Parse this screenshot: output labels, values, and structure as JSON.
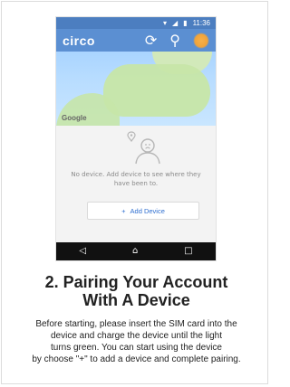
{
  "phone": {
    "status_time": "11:36",
    "app_logo": "circo",
    "map_watermark": "Google",
    "empty_message": "No device. Add device to see where they have been to.",
    "add_device_label": "Add Device",
    "icons": {
      "status": [
        "signal-icon",
        "wifi-icon",
        "battery-icon"
      ],
      "appbar": [
        "refresh-icon",
        "person-icon",
        "menu-icon"
      ],
      "nav": [
        "back-icon",
        "home-icon",
        "recents-icon"
      ]
    }
  },
  "step": {
    "title_line1": "2.  Pairing Your Account",
    "title_line2": "With A Device",
    "description_lines": [
      "Before starting, please insert the SIM card into the",
      "device and charge the device until the light",
      "turns green. You can start using the device",
      "by choose \"+\" to add a device and complete pairing."
    ]
  },
  "colors": {
    "app_blue": "#5b8fd2",
    "status_blue": "#4c7ec0",
    "accent_orange": "#f0a33a",
    "link_blue": "#2f6fd0"
  }
}
